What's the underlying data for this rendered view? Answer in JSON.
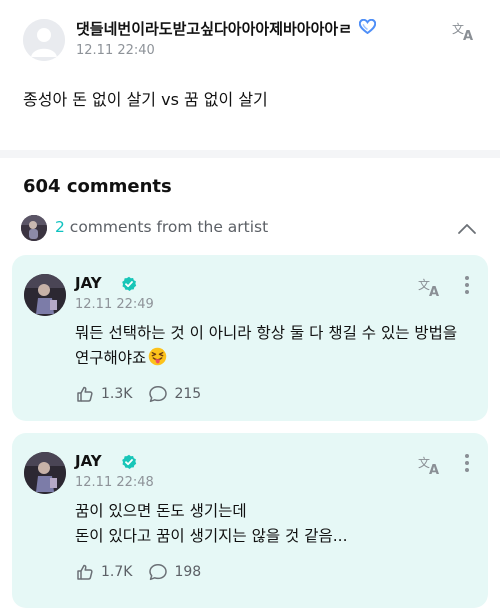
{
  "post": {
    "author": "댓들네번이라도받고싶다아아아제바아아아ㄹ",
    "time": "12.11 22:40",
    "body": "종성아 돈 없이 살기 vs 꿈 없이 살기"
  },
  "comments_count": "604 comments",
  "artist_section": {
    "count": "2",
    "label": " comments from the artist"
  },
  "comments": [
    {
      "name": "JAY",
      "time": "12.11 22:49",
      "text": "뭐든 선택하는 것 이 아니라 항상 둘 다 챙길 수 있는 방법을 연구해야죠",
      "likes": "1.3K",
      "replies": "215"
    },
    {
      "name": "JAY",
      "time": "12.11 22:48",
      "line1": "꿈이 있으면 돈도 생기는데",
      "line2": "돈이 있다고 꿈이 생기지는 않을 것 같음...",
      "likes": "1.7K",
      "replies": "198"
    }
  ],
  "colors": {
    "accent": "#0fc2c0",
    "card_bg": "#e6f8f6",
    "verified": "#18c6b8",
    "heart": "#4f8ff7"
  },
  "icons": [
    "avatar-placeholder",
    "blue-heart-icon",
    "translate-icon",
    "chevron-up-icon",
    "verified-badge-icon",
    "more-vertical-icon",
    "like-icon",
    "comment-icon",
    "squinting-tongue-emoji"
  ]
}
